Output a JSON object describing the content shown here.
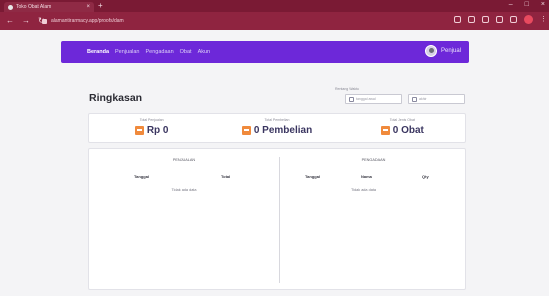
{
  "browser": {
    "tab_title": "Toko Obat Alam",
    "url": "alamantirarmacy.app/proofs/dam"
  },
  "nav": {
    "items": [
      "Beranda",
      "Penjualan",
      "Pengadaan",
      "Obat",
      "Akun"
    ],
    "active_index": 0,
    "user": "Penjual"
  },
  "page": {
    "title": "Ringkasan"
  },
  "date_filter": {
    "label": "Rentang Waktu",
    "start_placeholder": "tanggal awal",
    "end_placeholder": "akhir"
  },
  "stats": [
    {
      "label": "Total Penjualan",
      "value": "Rp 0",
      "icon": "money-icon"
    },
    {
      "label": "Total Pembelian",
      "value": "0 Pembelian",
      "icon": "cart-icon"
    },
    {
      "label": "Total Jenis Obat",
      "value": "0 Obat",
      "icon": "pill-icon"
    }
  ],
  "sales_table": {
    "title": "PENJUALAN",
    "columns": [
      "Tanggal",
      "Total"
    ],
    "empty": "Tidak ada data"
  },
  "procurement_table": {
    "title": "PENGADAAN",
    "columns": [
      "Tanggal",
      "Nama",
      "Qty"
    ],
    "empty": "Tidak ada data"
  },
  "colors": {
    "nav_bg": "#6d28d9",
    "accent_icon": "#f08a3c",
    "browser_chrome": "#8f2440"
  }
}
